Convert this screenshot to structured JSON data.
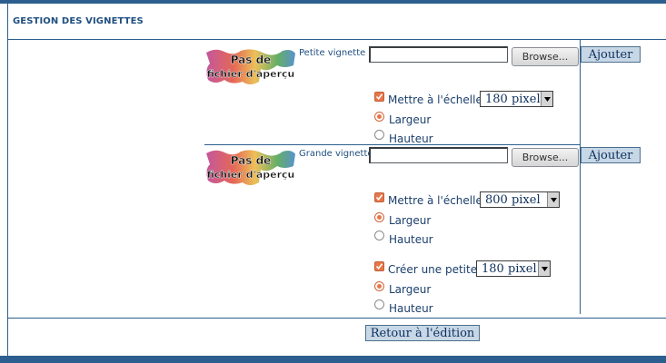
{
  "header": {
    "title": "GESTION DES VIGNETTES"
  },
  "placeholder_image": {
    "line1": "Pas de",
    "line2": "fichier d'aperçu"
  },
  "small_thumb": {
    "label": "Petite vignette",
    "browse_label": "Browse...",
    "add_label": "Ajouter",
    "scale_label": "Mettre à l'échelle",
    "scale_value": "180 pixel",
    "width_label": "Largeur",
    "height_label": "Hauteur"
  },
  "large_thumb": {
    "label": "Grande vignette",
    "browse_label": "Browse...",
    "add_label": "Ajouter",
    "scale_label": "Mettre à l'échelle",
    "scale_value": "800 pixel",
    "width_label": "Largeur",
    "height_label": "Hauteur",
    "create_small_label": "Créer une petite",
    "create_small_value": "180 pixel",
    "create_width_label": "Largeur",
    "create_height_label": "Hauteur"
  },
  "footer": {
    "back_label": "Retour à l'édition"
  }
}
